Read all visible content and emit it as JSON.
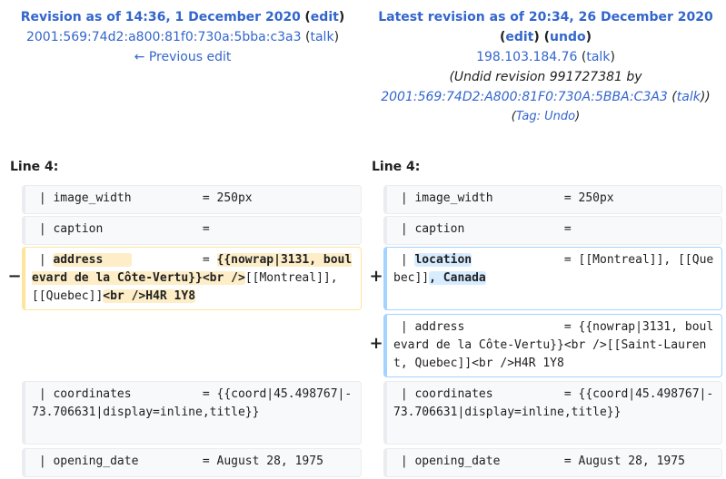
{
  "left_header": {
    "title": "Revision as of 14:36, 1 December 2020",
    "edit": "edit",
    "user": "2001:569:74d2:a800:81f0:730a:5bba:c3a3",
    "talk": "talk",
    "prev_link": "← Previous edit"
  },
  "right_header": {
    "title": "Latest revision as of 20:34, 26 December 2020",
    "edit": "edit",
    "undo": "undo",
    "user": "198.103.184.76",
    "talk": "talk",
    "summary_prefix": "(Undid revision 991727381 by",
    "summary_user": "2001:569:74D2:A800:81F0:730A:5BBA:C3A3",
    "summary_talk": "talk",
    "tag_label": "Tag:",
    "tag_value": "Undo"
  },
  "line_left": "Line 4:",
  "line_right": "Line 4:",
  "markers": {
    "minus": "−",
    "plus": "+"
  },
  "rows": {
    "image_width_left": " | image_width          = 250px",
    "image_width_right": " | image_width          = 250px",
    "caption_left": " | caption              =",
    "caption_right": " | caption              =",
    "del": {
      "pre": " | ",
      "chg1": "address    ",
      "mid": "          = ",
      "chg2": "{{nowrap|3131, boulevard de la Côte-Vertu}}<br />",
      "mid2": "[[Montreal]], [[Quebec]]",
      "chg3": "<br />H4R 1Y8"
    },
    "add1": {
      "pre": " | ",
      "chg1": "location",
      "mid": "             = [[Montreal]], [[Quebec]]",
      "chg2": ", Canada"
    },
    "add2": " | address              = {{nowrap|3131, boulevard de la Côte-Vertu}}<br />[[Saint-Laurent, Quebec]]<br />H4R 1Y8",
    "coord_left": " | coordinates          = {{coord|45.498767|-73.706631|display=inline,title}}",
    "coord_right": " | coordinates          = {{coord|45.498767|-73.706631|display=inline,title}}",
    "opening_left": " | opening_date         = August 28, 1975",
    "opening_right": " | opening_date         = August 28, 1975"
  }
}
